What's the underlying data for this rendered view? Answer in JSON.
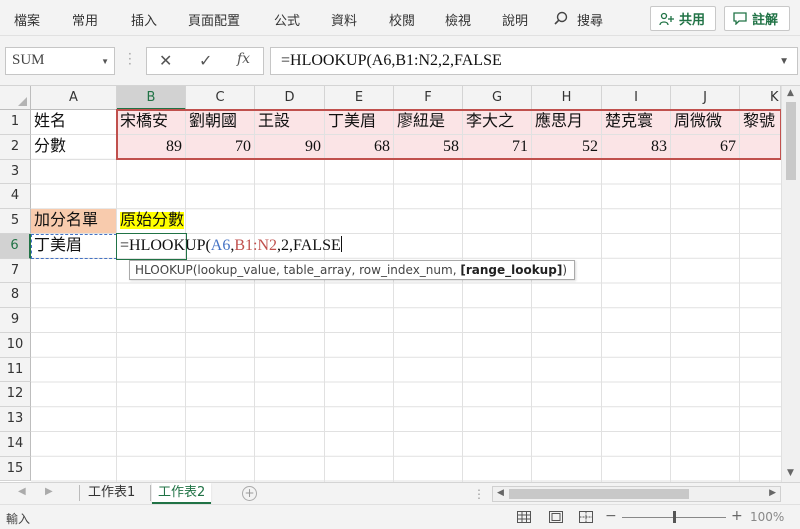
{
  "ribbon": {
    "tabs": [
      "檔案",
      "常用",
      "插入",
      "頁面配置",
      "公式",
      "資料",
      "校閱",
      "檢視",
      "說明"
    ],
    "search_label": "搜尋",
    "share_label": "共用",
    "comment_label": "註解"
  },
  "formula_bar": {
    "name_box": "SUM",
    "cancel_icon": "✕",
    "enter_icon": "✓",
    "fx_label": "fx",
    "formula": "=HLOOKUP(A6,B1:N2,2,FALSE"
  },
  "columns": [
    "A",
    "B",
    "C",
    "D",
    "E",
    "F",
    "G",
    "H",
    "I",
    "J",
    "K"
  ],
  "rows": [
    "1",
    "2",
    "3",
    "4",
    "5",
    "6",
    "7",
    "8",
    "9",
    "10",
    "11",
    "12",
    "13",
    "14",
    "15"
  ],
  "cells": {
    "A1": "姓名",
    "B1": "宋橋安",
    "C1": "劉朝國",
    "D1": "王設",
    "E1": "丁美眉",
    "F1": "廖紐是",
    "G1": "李大之",
    "H1": "應思月",
    "I1": "楚克寰",
    "J1": "周微微",
    "K1": "黎號",
    "A2": "分數",
    "B2": "89",
    "C2": "70",
    "D2": "90",
    "E2": "68",
    "F2": "58",
    "G2": "71",
    "H2": "52",
    "I2": "83",
    "J2": "67",
    "A5": "加分名單",
    "B5": "原始分數",
    "A6": "丁美眉"
  },
  "editing": {
    "prefix": "=HLOOKUP(",
    "ref1": "A6",
    "comma1": ",",
    "ref2": "B1:N2",
    "suffix": ",2,FALSE"
  },
  "tooltip": {
    "text": "HLOOKUP(lookup_value, table_array, row_index_num, ",
    "bold": "[range_lookup]",
    "close": ")"
  },
  "sheets": [
    "工作表1",
    "工作表2"
  ],
  "active_sheet": "工作表2",
  "status": {
    "mode": "輸入",
    "zoom": "100%"
  },
  "colors": {
    "accent": "#217346",
    "pink_fill": "#fbe4e6",
    "orange_fill": "#f8cbad",
    "yellow_fill": "#ffff00",
    "ref_blue": "#4472c4",
    "ref_red": "#c0504d"
  }
}
